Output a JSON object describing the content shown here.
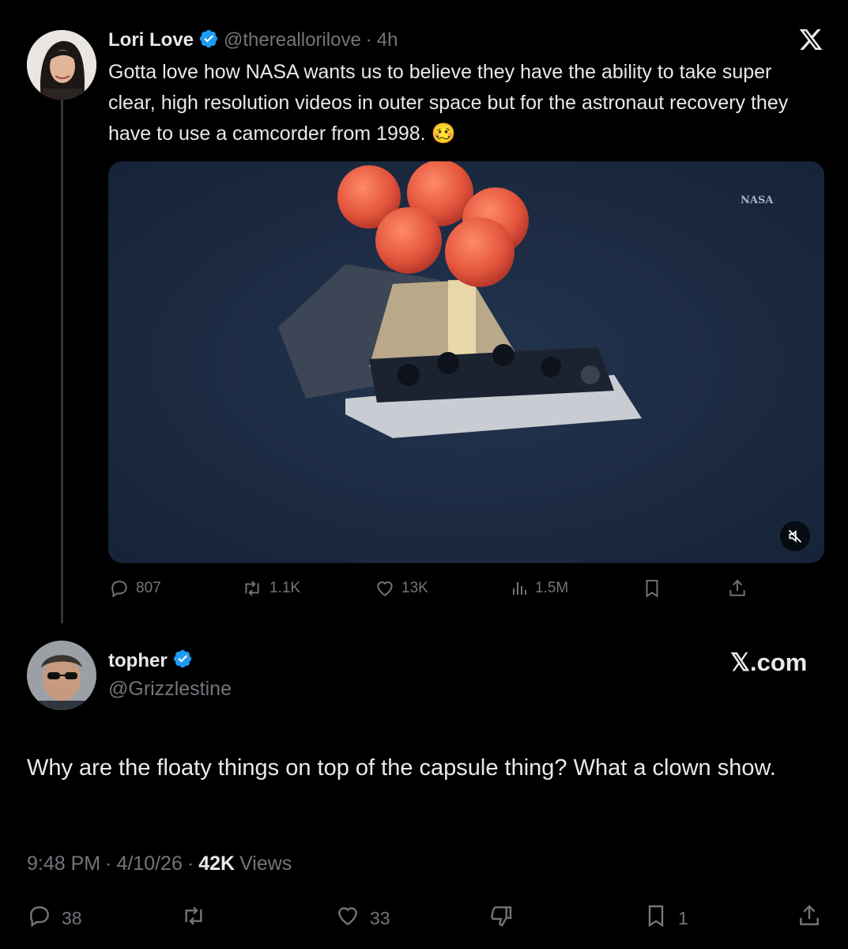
{
  "quoted": {
    "author_name": "Lori Love",
    "handle": "@thereallorilove",
    "separator": "·",
    "time": "4h",
    "text": "Gotta love how NASA wants us to believe they have the ability to take super clear, high resolution videos in outer space but for the astronaut recovery they have to use a camcorder from 1998. 🥴",
    "media_watermark": "NASA",
    "actions": {
      "replies": "807",
      "reposts": "1.1K",
      "likes": "13K",
      "views": "1.5M"
    }
  },
  "reply": {
    "author_name": "topher",
    "handle": "@Grizzlestine",
    "brand": "𝕏.com",
    "text": "Why are the floaty things on top of the capsule thing? What a clown show.",
    "meta": {
      "time": "9:48 PM",
      "sep1": "·",
      "date": "4/10/26",
      "sep2": "·",
      "views_count": "42K",
      "views_label": "Views"
    },
    "actions": {
      "replies": "38",
      "likes": "33",
      "bookmarks": "1"
    }
  },
  "colors": {
    "background": "#000000",
    "text": "#e7e9ea",
    "muted": "#71767b",
    "verified": "#1d9bf0"
  },
  "icons": [
    "x-logo-icon",
    "verified-badge-icon",
    "reply-icon",
    "repost-icon",
    "like-icon",
    "views-icon",
    "bookmark-icon",
    "share-icon",
    "dislike-icon",
    "mute-icon"
  ]
}
